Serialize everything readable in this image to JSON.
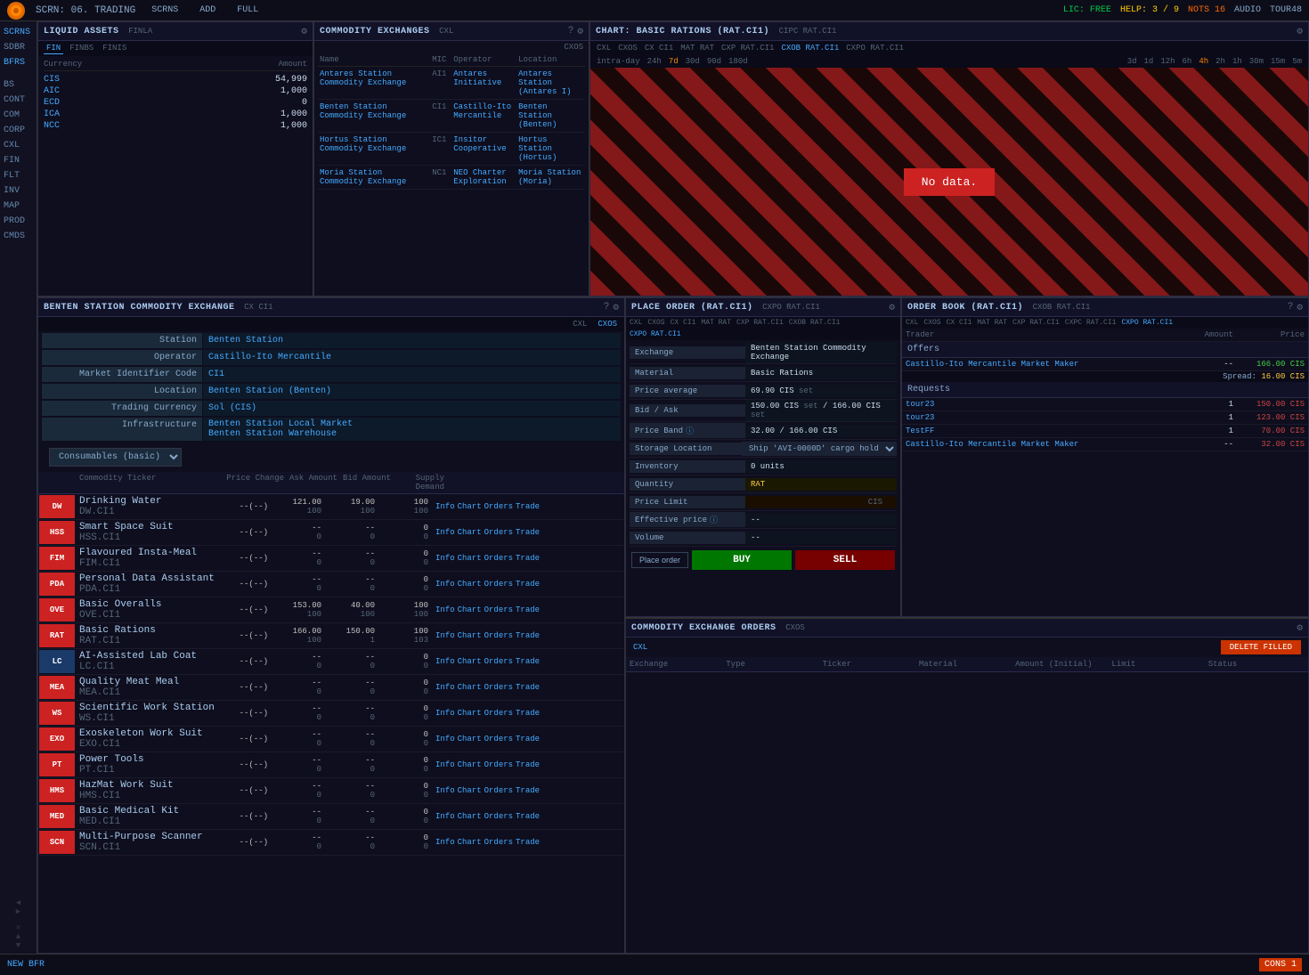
{
  "topbar": {
    "screen": "SCRN: 06. TRADING",
    "nav": [
      "SCRNS",
      "ADD",
      "FULL"
    ],
    "lic": "LIC: FREE",
    "help": "HELP: 3 / 9",
    "nots": "NOTS 16",
    "audio": "AUDIO",
    "tour": "TOUR48"
  },
  "sidebar": {
    "items": [
      "SCRNS",
      "SDBR",
      "BFRS",
      "",
      "BS",
      "CONT",
      "COM",
      "CORP",
      "CXL",
      "FIN",
      "FLT",
      "INV",
      "MAP",
      "PROD",
      "CMDS"
    ]
  },
  "liquidAssets": {
    "title": "LIQUID ASSETS",
    "subtitle": "FINLA",
    "tabs": [
      "FIN",
      "FINBS",
      "FINIS"
    ],
    "headers": [
      "Currency",
      "Amount"
    ],
    "rows": [
      {
        "currency": "CIS",
        "amount": "54,999"
      },
      {
        "currency": "AIC",
        "amount": "1,000"
      },
      {
        "currency": "ECD",
        "amount": "0"
      },
      {
        "currency": "ICA",
        "amount": "1,000"
      },
      {
        "currency": "NCC",
        "amount": "1,000"
      }
    ]
  },
  "commodityExchanges": {
    "title": "COMMODITY EXCHANGES",
    "subtitle": "CXL",
    "cxos": "CXOS",
    "headers": [
      "Name",
      "MIC",
      "Operator",
      "Location"
    ],
    "rows": [
      {
        "name": "Antares Station Commodity Exchange",
        "mic": "AI1",
        "operator": "Antares Initiative",
        "location": "Antares Station (Antares I)"
      },
      {
        "name": "Benten Station Commodity Exchange",
        "mic": "CI1",
        "operator": "Castillo-Ito Mercantile",
        "location": "Benten Station (Benten)"
      },
      {
        "name": "Hortus Station Commodity Exchange",
        "mic": "IC1",
        "operator": "Insitor Cooperative",
        "location": "Hortus Station (Hortus)"
      },
      {
        "name": "Moria Station Commodity Exchange",
        "mic": "NC1",
        "operator": "NEO Charter Exploration",
        "location": "Moria Station (Moria)"
      }
    ]
  },
  "chart": {
    "title": "CHART: BASIC RATIONS (RAT.CI1)",
    "subtitle": "CIPC RAT.CI1",
    "tabs": [
      "CXL",
      "CXOS",
      "CX CI1",
      "MAT RAT",
      "CXP RAT.CI1",
      "CXOB RAT.CI1",
      "CXPO RAT.CI1"
    ],
    "timeTabs": [
      "intra-day",
      "24h",
      "7d",
      "30d",
      "90d",
      "180d"
    ],
    "detailTimeTabs": [
      "3d",
      "1d",
      "12h",
      "6h",
      "4h",
      "2h",
      "1h",
      "30m",
      "15m",
      "5m"
    ],
    "noData": "No data."
  },
  "bentenStation": {
    "title": "BENTEN STATION COMMODITY EXCHANGE",
    "subtitle": "CX CI1",
    "tabs": [
      "CXL",
      "CXOS"
    ],
    "fields": [
      {
        "label": "Station",
        "value": "Benten Station"
      },
      {
        "label": "Operator",
        "value": "Castillo-Ito Mercantile"
      },
      {
        "label": "Market Identifier Code",
        "value": "CI1"
      },
      {
        "label": "Location",
        "value": "Benten Station (Benten)"
      },
      {
        "label": "Trading Currency",
        "value": "Sol (CIS)"
      },
      {
        "label": "Infrastructure",
        "values": [
          "Benten Station Local Market",
          "Benten Station Warehouse"
        ]
      }
    ],
    "category": "Consumables (basic)",
    "tableHeaders": [
      "Commodity Ticker",
      "Price Change",
      "Ask Amount",
      "Bid Amount",
      "Supply Demand"
    ],
    "commodities": [
      {
        "ticker": "DW",
        "color": "red",
        "name": "Drinking Water",
        "code": "DW.CI1",
        "price": "--",
        "priceChange": "--(--)",
        "ask": "121.00\n100",
        "bid": "19.00\n100",
        "supply": "100\n100"
      },
      {
        "ticker": "HSS",
        "color": "red",
        "name": "Smart Space Suit",
        "code": "HSS.CI1",
        "price": "--",
        "priceChange": "--(--)",
        "ask": "--\n0",
        "bid": "--\n0",
        "supply": "0\n0"
      },
      {
        "ticker": "FIM",
        "color": "red",
        "name": "Flavoured Insta-Meal",
        "code": "FIM.CI1",
        "price": "--",
        "priceChange": "--(--)",
        "ask": "--\n0",
        "bid": "--\n0",
        "supply": "0\n0"
      },
      {
        "ticker": "PDA",
        "color": "red",
        "name": "Personal Data Assistant",
        "code": "PDA.CI1",
        "price": "--",
        "priceChange": "--(--)",
        "ask": "--\n0",
        "bid": "--\n0",
        "supply": "0\n0"
      },
      {
        "ticker": "OVE",
        "color": "red",
        "name": "Basic Overalls",
        "code": "OVE.CI1",
        "price": "--",
        "priceChange": "--(--)",
        "ask": "153.00\n100",
        "bid": "40.00\n100",
        "supply": "100\n100"
      },
      {
        "ticker": "RAT",
        "color": "red",
        "name": "Basic Rations",
        "code": "RAT.CI1",
        "price": "--",
        "priceChange": "--(--)",
        "ask": "166.00\n100",
        "bid": "150.00\n1",
        "supply": "100\n103"
      },
      {
        "ticker": "LC",
        "color": "blue",
        "name": "AI-Assisted Lab Coat",
        "code": "LC.CI1",
        "price": "--",
        "priceChange": "--(--)",
        "ask": "--\n0",
        "bid": "--\n0",
        "supply": "0\n0"
      },
      {
        "ticker": "MEA",
        "color": "red",
        "name": "Quality Meat Meal",
        "code": "MEA.CI1",
        "price": "--",
        "priceChange": "--(--)",
        "ask": "--\n0",
        "bid": "--\n0",
        "supply": "0\n0"
      },
      {
        "ticker": "WS",
        "color": "red",
        "name": "Scientific Work Station",
        "code": "WS.CI1",
        "price": "--",
        "priceChange": "--(--)",
        "ask": "--\n0",
        "bid": "--\n0",
        "supply": "0\n0"
      },
      {
        "ticker": "EXO",
        "color": "red",
        "name": "Exoskeleton Work Suit",
        "code": "EXO.CI1",
        "price": "--",
        "priceChange": "--(--)",
        "ask": "--\n0",
        "bid": "--\n0",
        "supply": "0\n0"
      },
      {
        "ticker": "PT",
        "color": "red",
        "name": "Power Tools",
        "code": "PT.CI1",
        "price": "--",
        "priceChange": "--(--)",
        "ask": "--\n0",
        "bid": "--\n0",
        "supply": "0\n0"
      },
      {
        "ticker": "HMS",
        "color": "red",
        "name": "HazMat Work Suit",
        "code": "HMS.CI1",
        "price": "--",
        "priceChange": "--(--)",
        "ask": "--\n0",
        "bid": "--\n0",
        "supply": "0\n0"
      },
      {
        "ticker": "MED",
        "color": "red",
        "name": "Basic Medical Kit",
        "code": "MED.CI1",
        "price": "--",
        "priceChange": "--(--)",
        "ask": "--\n0",
        "bid": "--\n0",
        "supply": "0\n0"
      },
      {
        "ticker": "SCN",
        "color": "red",
        "name": "Multi-Purpose Scanner",
        "code": "SCN.CI1",
        "price": "--",
        "priceChange": "--(--)",
        "ask": "--\n0",
        "bid": "--\n0",
        "supply": "0\n0"
      }
    ]
  },
  "placeOrder": {
    "title": "PLACE ORDER (RAT.CI1)",
    "subtitle": "CXPO RAT.CI1",
    "tabs": [
      "CXL",
      "CXOS",
      "CX CI1",
      "MAT RAT",
      "CXP RAT.CI1",
      "CXOB RAT.CI1",
      "CXPO RAT.CI1"
    ],
    "fields": {
      "exchange": {
        "label": "Exchange",
        "value": "Benten Station Commodity Exchange"
      },
      "material": {
        "label": "Material",
        "value": "Basic Rations"
      },
      "priceAvg": {
        "label": "Price average",
        "value": "69.90 CIS set"
      },
      "bidAsk": {
        "label": "Bid / Ask",
        "value": "150.00 CIS set / 166.00 CIS set"
      },
      "priceBand": {
        "label": "Price Band",
        "value": "32.00 / 166.00 CIS",
        "hasInfo": true
      },
      "storageLocation": {
        "label": "Storage Location",
        "value": "Ship 'AVI-0000D' cargo hold"
      },
      "inventory": {
        "label": "Inventory",
        "value": "0 units"
      },
      "quantity": {
        "label": "Quantity",
        "value": "RAT"
      },
      "priceLimit": {
        "label": "Price Limit",
        "value": "CIS"
      },
      "effectivePrice": {
        "label": "Effective price",
        "value": "--",
        "hasInfo": true
      },
      "volume": {
        "label": "Volume",
        "value": "--"
      },
      "placeOrder": {
        "label": "Place order"
      }
    },
    "buyLabel": "BUY",
    "sellLabel": "SELL"
  },
  "orderBook": {
    "title": "ORDER BOOK (RAT.CI1)",
    "subtitle": "CXOB RAT.CI1",
    "tabs": [
      "CXL",
      "CXOS",
      "CX CI1",
      "MAT RAT",
      "CXP RAT.CI1",
      "CXPC RAT.CI1",
      "CXPO RAT.CI1"
    ],
    "headers": [
      "Trader",
      "Amount",
      "Price"
    ],
    "offers": {
      "title": "Offers",
      "rows": [
        {
          "trader": "Castillo-Ito Mercantile Market Maker",
          "amount": "--",
          "price": "166.00 CIS"
        },
        {
          "trader": "",
          "amount": "",
          "price": "Spread: 16.00 CIS"
        }
      ]
    },
    "requests": {
      "title": "Requests",
      "rows": [
        {
          "trader": "tour23",
          "amount": "1",
          "price": "150.00 CIS"
        },
        {
          "trader": "tour23",
          "amount": "1",
          "price": "123.00 CIS"
        },
        {
          "trader": "TestFF",
          "amount": "1",
          "price": "70.00 CIS"
        },
        {
          "trader": "Castillo-Ito Mercantile Market Maker",
          "amount": "--",
          "price": "32.00 CIS"
        }
      ]
    }
  },
  "ceoPanel": {
    "title": "COMMODITY EXCHANGE ORDERS",
    "subtitle": "CXOS",
    "cxlTab": "CXL",
    "deleteFilledBtn": "DELETE FILLED",
    "headers": [
      "Exchange",
      "Type",
      "Ticker",
      "Material",
      "Amount (Initial)",
      "Limit",
      "Status"
    ]
  },
  "bottomBar": {
    "newBfr": "NEW BFR",
    "cons1": "CONS 1"
  },
  "colors": {
    "accent": "#44aaff",
    "green": "#44cc44",
    "red": "#cc4444",
    "orange": "#ff8800",
    "dim": "#556677"
  }
}
